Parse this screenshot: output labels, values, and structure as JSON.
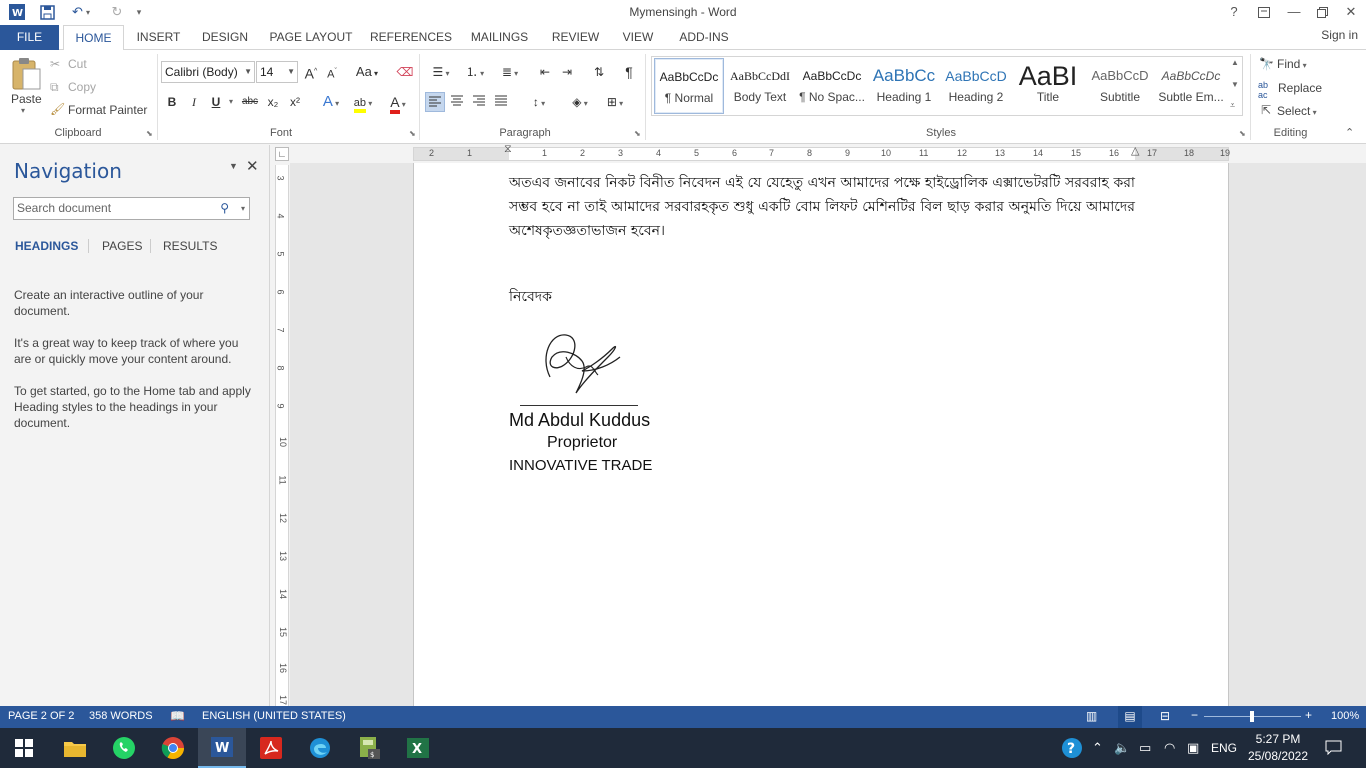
{
  "window": {
    "title": "Mymensingh - Word",
    "help_label": "?",
    "sign_in": "Sign in"
  },
  "tabs": [
    "FILE",
    "HOME",
    "INSERT",
    "DESIGN",
    "PAGE LAYOUT",
    "REFERENCES",
    "MAILINGS",
    "REVIEW",
    "VIEW",
    "ADD-INS"
  ],
  "ribbon": {
    "clipboard": {
      "paste": "Paste",
      "cut": "Cut",
      "copy": "Copy",
      "format_painter": "Format Painter",
      "label": "Clipboard"
    },
    "font": {
      "family": "Calibri (Body)",
      "size": "14",
      "label": "Font",
      "bold": "B",
      "italic": "I",
      "underline": "U",
      "strike": "abc",
      "subscript": "x₂",
      "superscript": "x²",
      "case": "Aa",
      "grow": "A",
      "shrink": "A",
      "text_effects": "A",
      "font_color": "A"
    },
    "paragraph": {
      "label": "Paragraph",
      "show_marks": "¶"
    },
    "styles": {
      "label": "Styles",
      "items": [
        {
          "preview": "AaBbCcDc",
          "name": "¶ Normal"
        },
        {
          "preview": "AaBbCcDdI",
          "name": "Body Text"
        },
        {
          "preview": "AaBbCcDc",
          "name": "¶ No Spac..."
        },
        {
          "preview": "AaBbCc",
          "name": "Heading 1"
        },
        {
          "preview": "AaBbCcD",
          "name": "Heading 2"
        },
        {
          "preview": "AaBI",
          "name": "Title"
        },
        {
          "preview": "AaBbCcD",
          "name": "Subtitle"
        },
        {
          "preview": "AaBbCcDc",
          "name": "Subtle Em..."
        }
      ]
    },
    "editing": {
      "label": "Editing",
      "find": "Find",
      "replace": "Replace",
      "select": "Select"
    }
  },
  "navigation": {
    "title": "Navigation",
    "search_placeholder": "Search document",
    "tabs": [
      "HEADINGS",
      "PAGES",
      "RESULTS"
    ],
    "hint1": "Create an interactive outline of your document.",
    "hint2": "It's a great way to keep track of where you are or quickly move your content around.",
    "hint3": "To get started, go to the Home tab and apply Heading styles to the headings in your document."
  },
  "ruler": {
    "h_numbers": [
      "2",
      "1",
      "1",
      "2",
      "3",
      "4",
      "5",
      "6",
      "7",
      "8",
      "9",
      "10",
      "11",
      "12",
      "13",
      "14",
      "15",
      "16",
      "17",
      "18",
      "19"
    ],
    "v_numbers": [
      "3",
      "4",
      "5",
      "6",
      "7",
      "8",
      "9",
      "10",
      "11",
      "12",
      "13",
      "14",
      "15",
      "16",
      "17"
    ]
  },
  "document": {
    "paragraph": "অতএব জনাবের নিকট বিনীত নিবেদন এই যে যেহেতু এখন আমাদের পক্ষে হাইড্রোলিক এক্সাভেটরটি সরবরাহ করা সম্ভব হবে না তাই আমাদের সরবারহকৃত  শুধু একটি বোম লিফট মেশিনটির বিল ছাড় করার অনুমতি দিয়ে আমাদের অশেষকৃতজ্ঞতাভাজন হবেন।",
    "nibedok": "নিবেদক",
    "name": "Md Abdul Kuddus",
    "role": "Proprietor",
    "org": "INNOVATIVE TRADE"
  },
  "status": {
    "page": "PAGE 2 OF 2",
    "words": "358 WORDS",
    "language": "ENGLISH (UNITED STATES)",
    "zoom": "100%"
  },
  "taskbar": {
    "lang": "ENG",
    "time": "5:27 PM",
    "date": "25/08/2022"
  }
}
